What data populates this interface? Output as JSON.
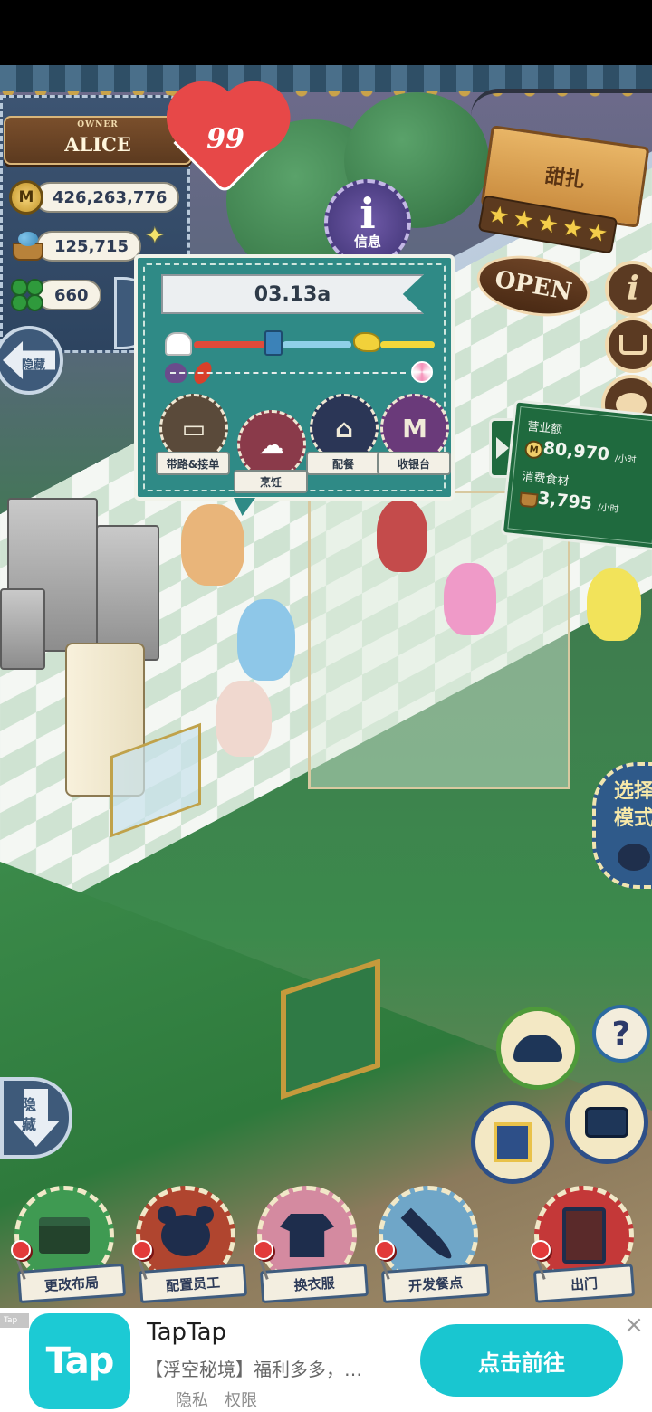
{
  "owner": {
    "label": "OWNER",
    "name": "ALICE",
    "coins": "426,263,776",
    "food": "125,715",
    "clovers": "660",
    "coin_symbol": "M",
    "hide_label": "隐藏"
  },
  "hearts": "99",
  "info_button": {
    "glyph": "i",
    "label": "信息"
  },
  "staff_popup": {
    "name": "03.13a",
    "jobs": [
      {
        "label": "带路&接单",
        "icon": "table-icon"
      },
      {
        "label": "烹饪",
        "icon": "chef-hat-icon"
      },
      {
        "label": "配餐",
        "icon": "serving-tray-icon"
      },
      {
        "label": "收银台",
        "icon": "coin-icon",
        "glyph": "M"
      }
    ]
  },
  "restaurant": {
    "name": "甜扎",
    "stars": 5,
    "status": "OPEN"
  },
  "revenue": {
    "title": "营业额",
    "revenue_value": "80,970",
    "per_hour": "/小时",
    "ingredients_title": "消费食材",
    "ingredients_value": "3,795",
    "coin_symbol": "M"
  },
  "mode_button": {
    "line1": "选择",
    "line2": "模式"
  },
  "side_icons": {
    "info": "i",
    "help": "?",
    "hide_bottom": "隐藏"
  },
  "actions": [
    {
      "label": "更改布局",
      "color": "#3f9a52",
      "icon": "table-icon"
    },
    {
      "label": "配置员工",
      "color": "#b0452f",
      "icon": "bear-icon"
    },
    {
      "label": "换衣服",
      "color": "#d48aa0",
      "icon": "shirt-icon"
    },
    {
      "label": "开发餐点",
      "color": "#6fa6c8",
      "icon": "knife-icon"
    },
    {
      "label": "出门",
      "color": "#c43838",
      "icon": "door-icon"
    }
  ],
  "ad": {
    "tag": "Tap",
    "logo": "Tap",
    "title": "TapTap",
    "description": "【浮空秘境】福利多多，…",
    "privacy": "隐私",
    "permissions": "权限",
    "cta": "点击前往",
    "close": "×"
  }
}
